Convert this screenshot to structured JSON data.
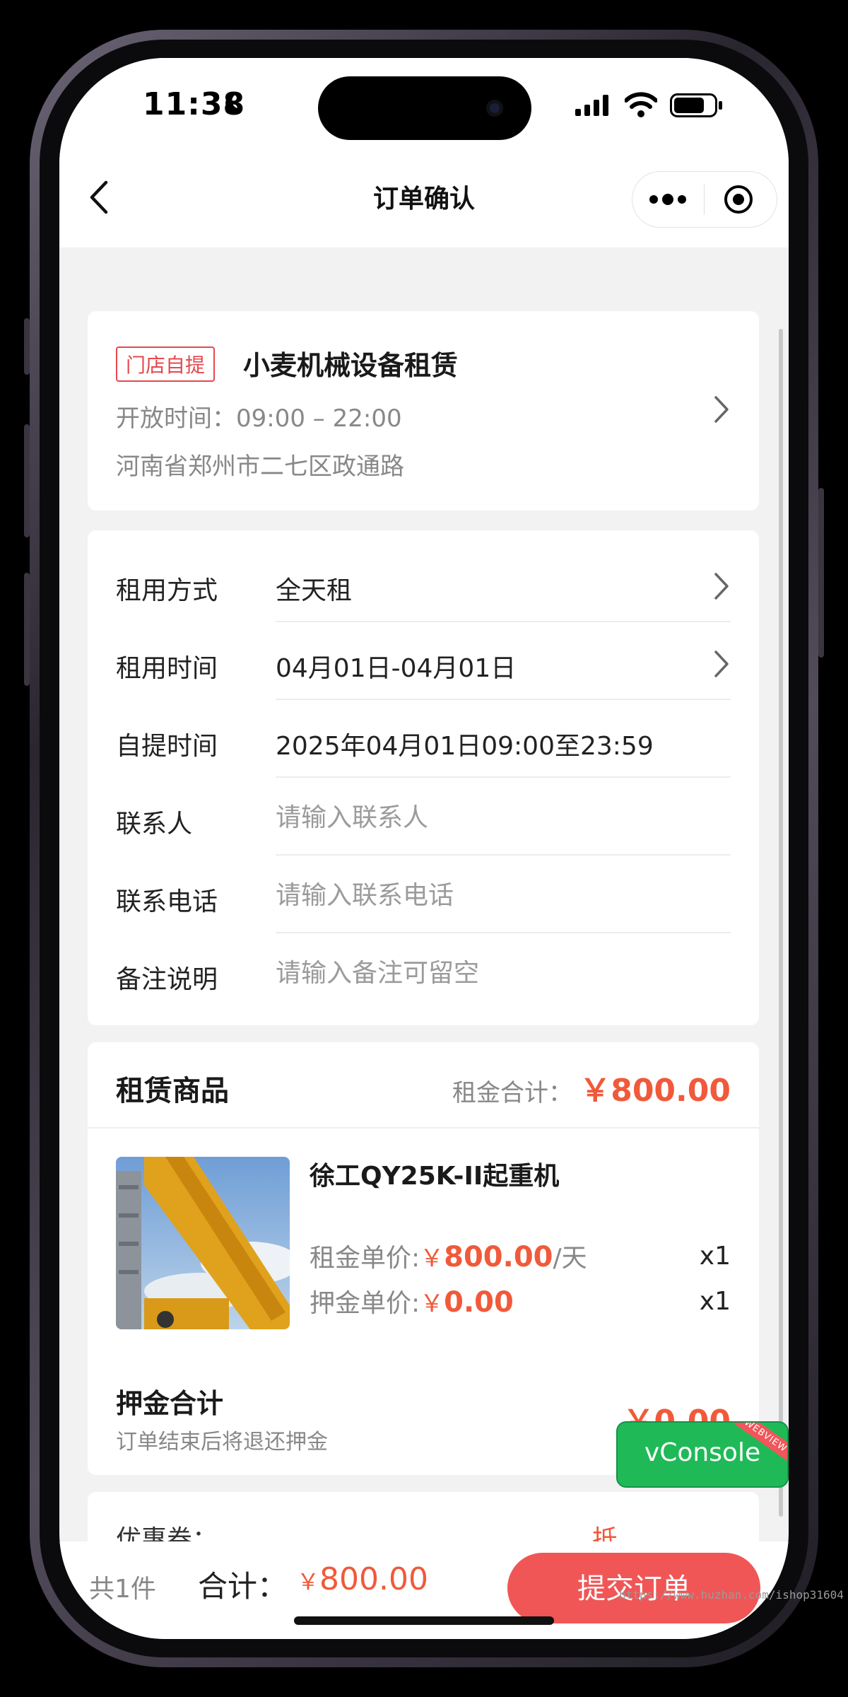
{
  "status_bar": {
    "time": "11:38"
  },
  "nav": {
    "title": "订单确认"
  },
  "store": {
    "tag": "门店自提",
    "name": "小麦机械设备租赁",
    "hours": "开放时间：09:00 – 22:00",
    "address": "河南省郑州市二七区政通路"
  },
  "form": {
    "rental_mode_label": "租用方式",
    "rental_mode_value": "全天租",
    "rental_time_label": "租用时间",
    "rental_time_value": "04月01日-04月01日",
    "pickup_time_label": "自提时间",
    "pickup_time_value": "2025年04月01日09:00至23:59",
    "contact_label": "联系人",
    "contact_placeholder": "请输入联系人",
    "phone_label": "联系电话",
    "phone_placeholder": "请输入联系电话",
    "remark_label": "备注说明",
    "remark_placeholder": "请输入备注可留空"
  },
  "goods": {
    "title": "租赁商品",
    "rent_total_label": "租金合计：",
    "rent_total_value": "￥800.00",
    "product": {
      "name": "徐工QY25K-II起重机",
      "rent_price_label": "租金单价:",
      "currency": "￥",
      "rent_price": "800.00",
      "rent_unit": "/天",
      "rent_qty": "x1",
      "deposit_price_label": "押金单价:",
      "deposit_price": "0.00",
      "deposit_qty": "x1"
    },
    "deposit_total_label": "押金合计",
    "deposit_note": "订单结束后将退还押金",
    "deposit_total_value": "￥0.00"
  },
  "coupon": {
    "label": "优惠券：",
    "value": "抵"
  },
  "bottom": {
    "count": "共1件",
    "total_label": "合计：",
    "currency": "￥",
    "total_value": "800.00",
    "submit": "提交订单"
  },
  "vconsole": {
    "label": "vConsole",
    "badge": "WEBVIEW"
  },
  "watermark": "https://www.huzhan.com/ishop31604",
  "colors": {
    "accent_red": "#f05a3a",
    "submit_red": "#f05656",
    "vconsole_green": "#1fba57"
  },
  "icons": [
    "back-icon",
    "more-icon",
    "target-icon",
    "chevron-right-icon",
    "moon-icon",
    "signal-icon",
    "wifi-icon",
    "battery-icon"
  ]
}
